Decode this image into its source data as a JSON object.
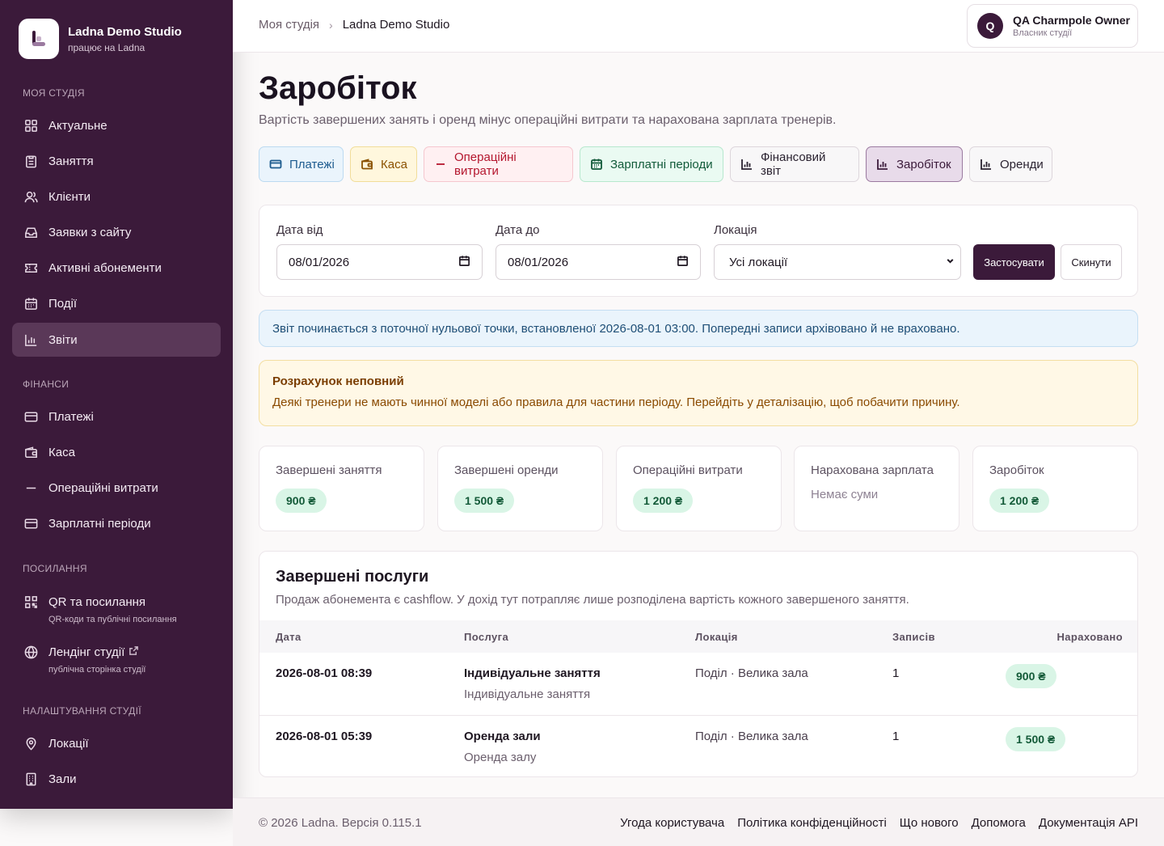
{
  "brand": {
    "title": "Ladna Demo Studio",
    "subtitle": "працює на Ladna"
  },
  "sidebar": {
    "section_studio": "Моя студія",
    "items": [
      {
        "label": "Актуальне",
        "icon": "grid-icon"
      },
      {
        "label": "Заняття",
        "icon": "clipboard-icon"
      },
      {
        "label": "Клієнти",
        "icon": "users-icon"
      },
      {
        "label": "Заявки з сайту",
        "icon": "inbox-icon"
      },
      {
        "label": "Активні абонементи",
        "icon": "ticket-icon"
      },
      {
        "label": "Події",
        "icon": "calendar-icon"
      },
      {
        "label": "Звіти",
        "icon": "chart-icon",
        "active": true
      }
    ],
    "section_finance": "Фінанси",
    "finance_items": [
      {
        "label": "Платежі",
        "icon": "card-icon"
      },
      {
        "label": "Каса",
        "icon": "wallet-icon"
      },
      {
        "label": "Операційні витрати",
        "icon": "minus-icon"
      },
      {
        "label": "Зарплатні періоди",
        "icon": "card-icon"
      }
    ],
    "section_links": "Посилання",
    "link_items": [
      {
        "label": "QR та посилання",
        "sub": "QR-коди та публічні посилання",
        "icon": "qr-icon"
      },
      {
        "label": "Лендінг студії",
        "sub": "публічна сторінка студії",
        "icon": "globe-icon"
      }
    ],
    "section_settings": "Налаштування студії",
    "settings_items": [
      {
        "label": "Локації",
        "icon": "pin-icon"
      },
      {
        "label": "Зали",
        "icon": "building-icon"
      }
    ]
  },
  "header": {
    "breadcrumb": [
      "Моя студія",
      "Ladna Demo Studio"
    ],
    "user": {
      "initial": "Q",
      "name": "QA Charmpole Owner",
      "role": "Власник студії"
    }
  },
  "page": {
    "title": "Заробіток",
    "subtitle": "Вартість завершених занять і оренд мінус операційні витрати та нарахована зарплата тренерів."
  },
  "tabs": [
    {
      "label": "Платежі",
      "icon": "card-icon"
    },
    {
      "label": "Каса",
      "icon": "wallet-icon"
    },
    {
      "label": "Операційні витрати",
      "icon": "minus-icon"
    },
    {
      "label": "Зарплатні періоди",
      "icon": "calendar-icon"
    },
    {
      "label": "Фінансовий звіт",
      "icon": "chart-icon"
    },
    {
      "label": "Заробіток",
      "icon": "chart-icon",
      "active": true
    },
    {
      "label": "Оренди",
      "icon": "chart-icon"
    }
  ],
  "filters": {
    "date_from_label": "Дата від",
    "date_from_value": "08/01/2026",
    "date_to_label": "Дата до",
    "date_to_value": "08/01/2026",
    "location_label": "Локація",
    "location_value": "Усі локації",
    "apply_label": "Застосувати",
    "reset_label": "Скинути"
  },
  "info_banner": "Звіт починається з поточної нульової точки, встановленої 2026-08-01 03:00. Попередні записи архівовано й не враховано.",
  "warning": {
    "title": "Розрахунок неповний",
    "text": "Деякі тренери не мають чинної моделі або правила для частини періоду. Перейдіть у деталізацію, щоб побачити причину."
  },
  "stats": [
    {
      "label": "Завершені заняття",
      "value": "900 ₴"
    },
    {
      "label": "Завершені оренди",
      "value": "1 500 ₴"
    },
    {
      "label": "Операційні витрати",
      "value": "1 200 ₴"
    },
    {
      "label": "Нарахована зарплата",
      "value": "Немає суми"
    },
    {
      "label": "Заробіток",
      "value": "1 200 ₴"
    }
  ],
  "services": {
    "title": "Завершені послуги",
    "subtitle": "Продаж абонемента є cashflow. У дохід тут потрапляє лише розподілена вартість кожного завершеного заняття.",
    "columns": [
      "Дата",
      "Послуга",
      "Локація",
      "Записів",
      "Нараховано"
    ],
    "rows": [
      {
        "date": "2026-08-01 08:39",
        "service": "Індивідуальне заняття",
        "service_sub": "Індивідуальне заняття",
        "location": "Поділ · Велика зала",
        "count": "1",
        "amount": "900 ₴"
      },
      {
        "date": "2026-08-01 05:39",
        "service": "Оренда зали",
        "service_sub": "Оренда залу",
        "location": "Поділ · Велика зала",
        "count": "1",
        "amount": "1 500 ₴"
      }
    ]
  },
  "footer": {
    "copyright": "© 2026 Ladna. Версія 0.115.1",
    "links": [
      "Угода користувача",
      "Політика конфіденційності",
      "Що нового",
      "Допомога",
      "Документація API"
    ]
  }
}
